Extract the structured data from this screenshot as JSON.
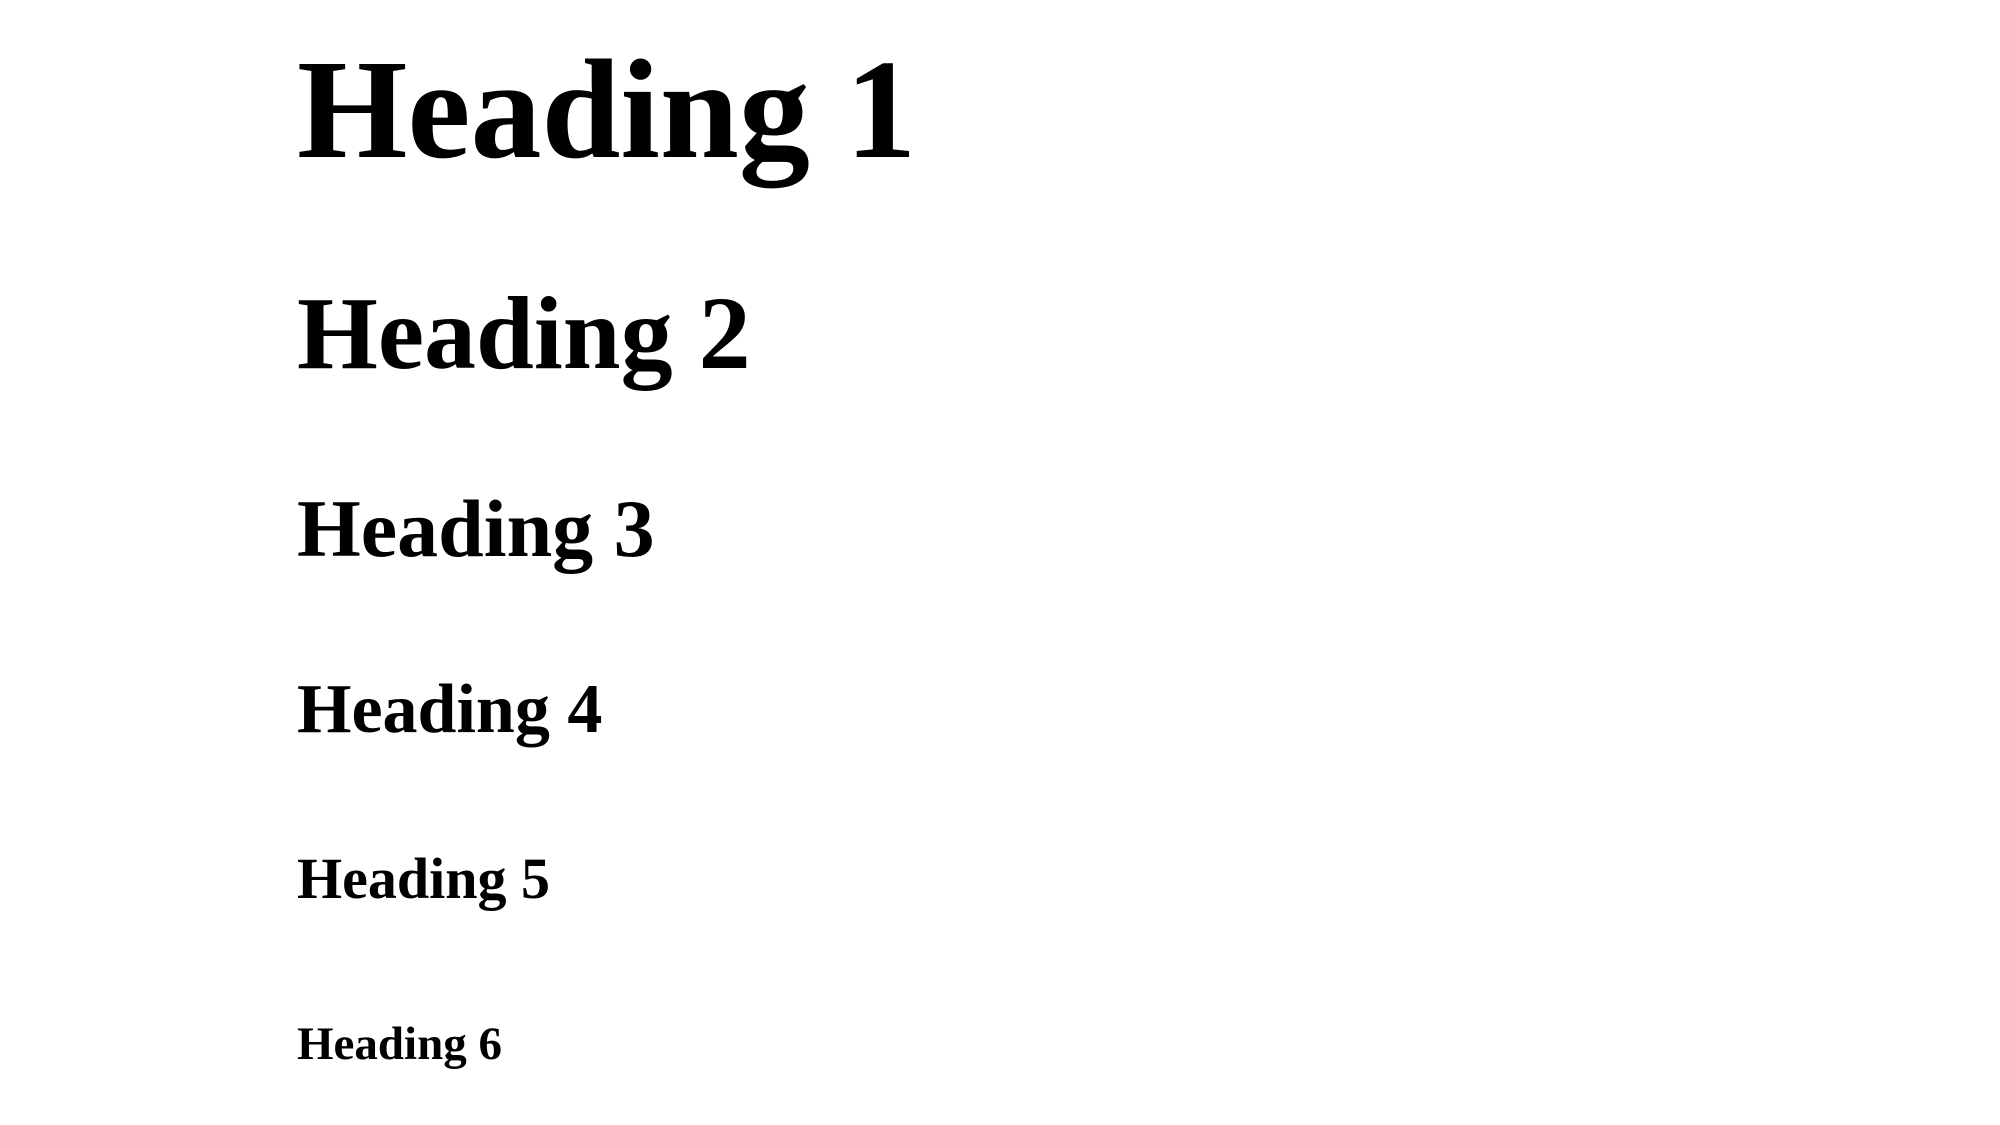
{
  "headings": {
    "h1": "Heading 1",
    "h2": "Heading 2",
    "h3": "Heading 3",
    "h4": "Heading 4",
    "h5": "Heading 5",
    "h6": "Heading 6"
  },
  "colors": {
    "background": "#ffffff",
    "text": "#000000"
  }
}
